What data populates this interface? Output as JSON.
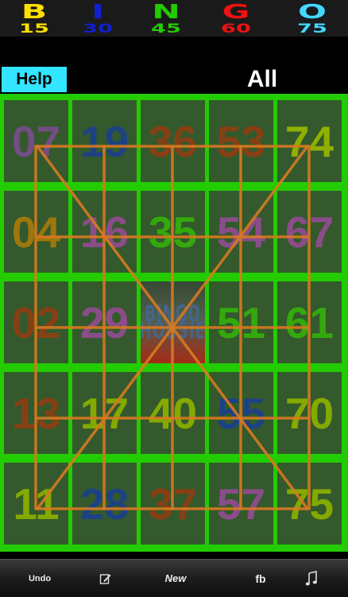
{
  "header": {
    "columns": [
      {
        "letter": "B",
        "max": "15",
        "color": "#ffe000"
      },
      {
        "letter": "I",
        "max": "30",
        "color": "#1020d0"
      },
      {
        "letter": "N",
        "max": "45",
        "color": "#22cc00"
      },
      {
        "letter": "G",
        "max": "60",
        "color": "#ee1111"
      },
      {
        "letter": "O",
        "max": "75",
        "color": "#44d8ff"
      }
    ]
  },
  "help_label": "Help",
  "mode_label": "All",
  "board": {
    "rows": [
      [
        "07",
        "19",
        "36",
        "53",
        "74"
      ],
      [
        "04",
        "16",
        "35",
        "54",
        "67"
      ],
      [
        "02",
        "29",
        "FREE",
        "51",
        "61"
      ],
      [
        "13",
        "17",
        "40",
        "55",
        "70"
      ],
      [
        "11",
        "28",
        "37",
        "57",
        "75"
      ]
    ],
    "colors": [
      [
        "#8a2aa8",
        "#1c1ca8",
        "#a21a1a",
        "#a21a1a",
        "#b0a800"
      ],
      [
        "#c06010",
        "#a82ab0",
        "#3aa010",
        "#a82ab0",
        "#a82ab0"
      ],
      [
        "#a21a1a",
        "#a82ab0",
        "",
        "#3aa010",
        "#3aa010"
      ],
      [
        "#a21a1a",
        "#a0a000",
        "#a0a000",
        "#1c1ca8",
        "#a0a000"
      ],
      [
        "#a0a000",
        "#1c1ca8",
        "#a21a1a",
        "#a82ab0",
        "#a0a000"
      ]
    ],
    "free_lines": [
      "BINGO",
      "HOUSIE"
    ]
  },
  "toolbar": {
    "undo": "Undo",
    "edit_icon": "edit-icon",
    "new": "New",
    "fb": "fb",
    "music_icon": "music-note-icon"
  },
  "colors": {
    "board_line": "#22cc00",
    "cell_bg": "#3a3a3a",
    "pattern_line": "#d87a20",
    "help_bg": "#33e6ff"
  }
}
